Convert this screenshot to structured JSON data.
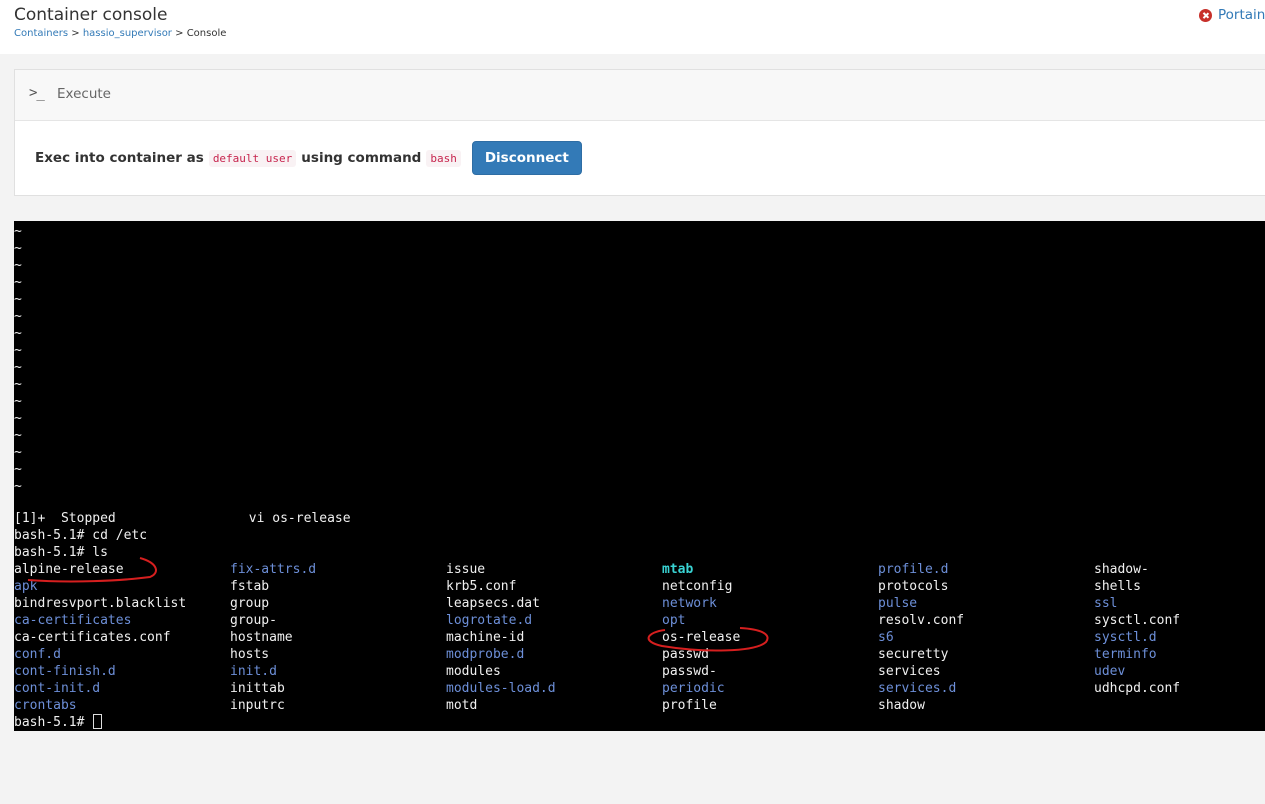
{
  "header": {
    "title": "Container console",
    "breadcrumb": {
      "containers": "Containers",
      "container": "hassio_supervisor",
      "current": "Console",
      "separator": ">"
    },
    "brand": "Portain"
  },
  "execute": {
    "title": "Execute",
    "icon": "terminal-prompt-icon",
    "text_prefix": "Exec into container as",
    "user": "default user",
    "text_middle": "using command",
    "command": "bash",
    "button_label": "Disconnect"
  },
  "terminal": {
    "tilde_rows": [
      "~",
      "~",
      "~",
      "~",
      "~",
      "~",
      "~",
      "~",
      "~",
      "~",
      "~",
      "~",
      "~",
      "~",
      "~",
      "~"
    ],
    "stopped_line": "[1]+  Stopped                 vi os-release",
    "cd_line": "bash-5.1# cd /etc",
    "ls_line": "bash-5.1# ls",
    "prompt": "bash-5.1# ",
    "columns": [
      [
        {
          "name": "alpine-release",
          "type": "file"
        },
        {
          "name": "apk",
          "type": "dir"
        },
        {
          "name": "bindresvport.blacklist",
          "type": "file"
        },
        {
          "name": "ca-certificates",
          "type": "dir"
        },
        {
          "name": "ca-certificates.conf",
          "type": "file"
        },
        {
          "name": "conf.d",
          "type": "dir"
        },
        {
          "name": "cont-finish.d",
          "type": "dir"
        },
        {
          "name": "cont-init.d",
          "type": "dir"
        },
        {
          "name": "crontabs",
          "type": "dir"
        }
      ],
      [
        {
          "name": "fix-attrs.d",
          "type": "dir"
        },
        {
          "name": "fstab",
          "type": "file"
        },
        {
          "name": "group",
          "type": "file"
        },
        {
          "name": "group-",
          "type": "file"
        },
        {
          "name": "hostname",
          "type": "file"
        },
        {
          "name": "hosts",
          "type": "file"
        },
        {
          "name": "init.d",
          "type": "dir"
        },
        {
          "name": "inittab",
          "type": "file"
        },
        {
          "name": "inputrc",
          "type": "file"
        }
      ],
      [
        {
          "name": "issue",
          "type": "file"
        },
        {
          "name": "krb5.conf",
          "type": "file"
        },
        {
          "name": "leapsecs.dat",
          "type": "file"
        },
        {
          "name": "logrotate.d",
          "type": "dir"
        },
        {
          "name": "machine-id",
          "type": "file"
        },
        {
          "name": "modprobe.d",
          "type": "dir"
        },
        {
          "name": "modules",
          "type": "file"
        },
        {
          "name": "modules-load.d",
          "type": "dir"
        },
        {
          "name": "motd",
          "type": "file"
        }
      ],
      [
        {
          "name": "mtab",
          "type": "link"
        },
        {
          "name": "netconfig",
          "type": "file"
        },
        {
          "name": "network",
          "type": "dir"
        },
        {
          "name": "opt",
          "type": "dir"
        },
        {
          "name": "os-release",
          "type": "file"
        },
        {
          "name": "passwd",
          "type": "file"
        },
        {
          "name": "passwd-",
          "type": "file"
        },
        {
          "name": "periodic",
          "type": "dir"
        },
        {
          "name": "profile",
          "type": "file"
        }
      ],
      [
        {
          "name": "profile.d",
          "type": "dir"
        },
        {
          "name": "protocols",
          "type": "file"
        },
        {
          "name": "pulse",
          "type": "dir"
        },
        {
          "name": "resolv.conf",
          "type": "file"
        },
        {
          "name": "s6",
          "type": "dir"
        },
        {
          "name": "securetty",
          "type": "file"
        },
        {
          "name": "services",
          "type": "file"
        },
        {
          "name": "services.d",
          "type": "dir"
        },
        {
          "name": "shadow",
          "type": "file"
        }
      ],
      [
        {
          "name": "shadow-",
          "type": "file"
        },
        {
          "name": "shells",
          "type": "file"
        },
        {
          "name": "ssl",
          "type": "dir"
        },
        {
          "name": "sysctl.conf",
          "type": "file"
        },
        {
          "name": "sysctl.d",
          "type": "dir"
        },
        {
          "name": "terminfo",
          "type": "dir"
        },
        {
          "name": "udev",
          "type": "dir"
        },
        {
          "name": "udhcpd.conf",
          "type": "file"
        }
      ]
    ]
  },
  "colors": {
    "link": "#337ab7",
    "button": "#337ab7",
    "terminal_bg": "#000000",
    "dir": "#6d8fd8",
    "symlink": "#39d3d3",
    "annotation": "#d61f1f"
  }
}
